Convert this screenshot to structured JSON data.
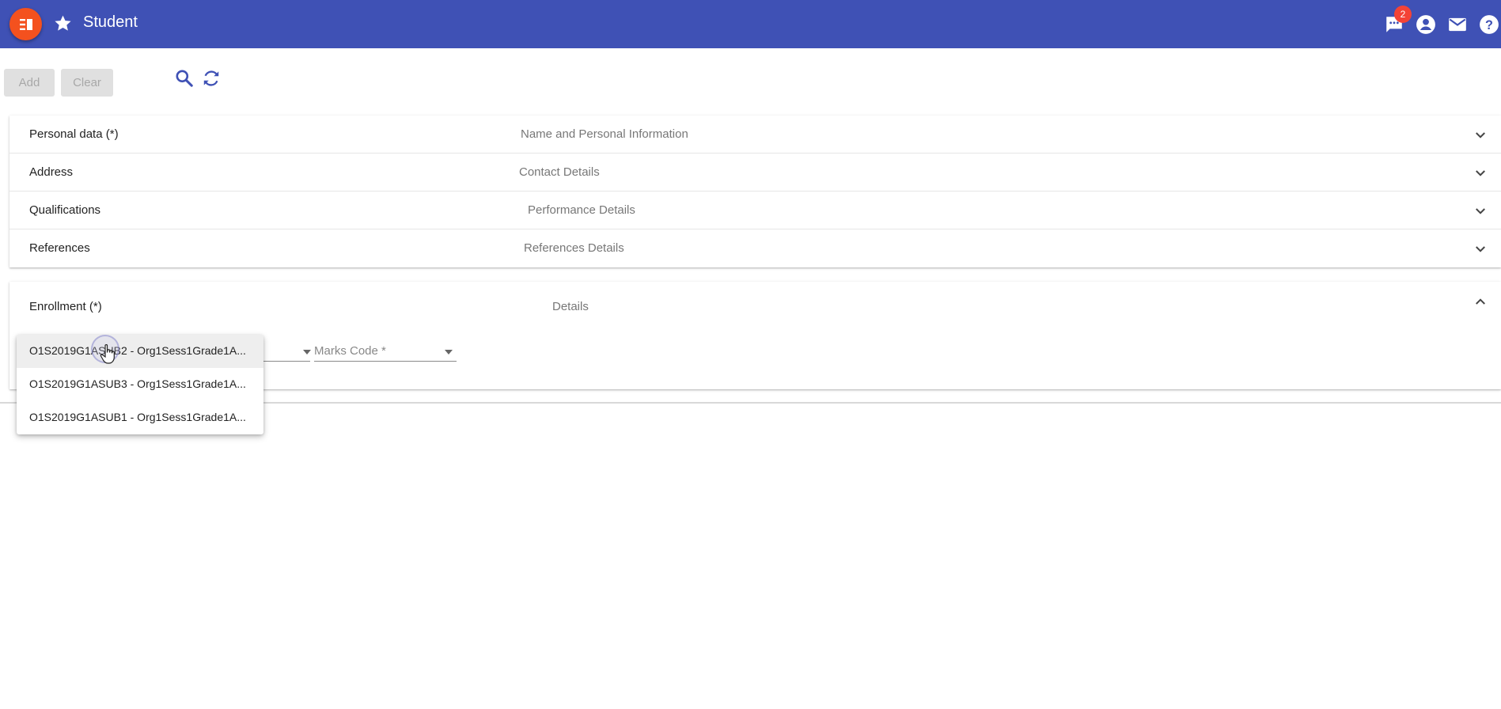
{
  "header": {
    "title": "Student",
    "notifications_count": "2",
    "colors": {
      "bar": "#3f51b5",
      "menu_button": "#f4511e",
      "badge": "#f44336"
    }
  },
  "toolbar": {
    "add_label": "Add",
    "clear_label": "Clear"
  },
  "sections": [
    {
      "title": "Personal data (*)",
      "description": "Name and Personal Information"
    },
    {
      "title": "Address",
      "description": "Contact Details"
    },
    {
      "title": "Qualifications",
      "description": "Performance Details"
    },
    {
      "title": "References",
      "description": "References Details"
    }
  ],
  "enrollment": {
    "title": "Enrollment (*)",
    "description": "Details",
    "marks_code_label": "Marks Code *",
    "dropdown_options": [
      "O1S2019G1ASUB2 - Org1Sess1Grade1A...",
      "O1S2019G1ASUB3 - Org1Sess1Grade1A...",
      "O1S2019G1ASUB1 - Org1Sess1Grade1A..."
    ]
  }
}
